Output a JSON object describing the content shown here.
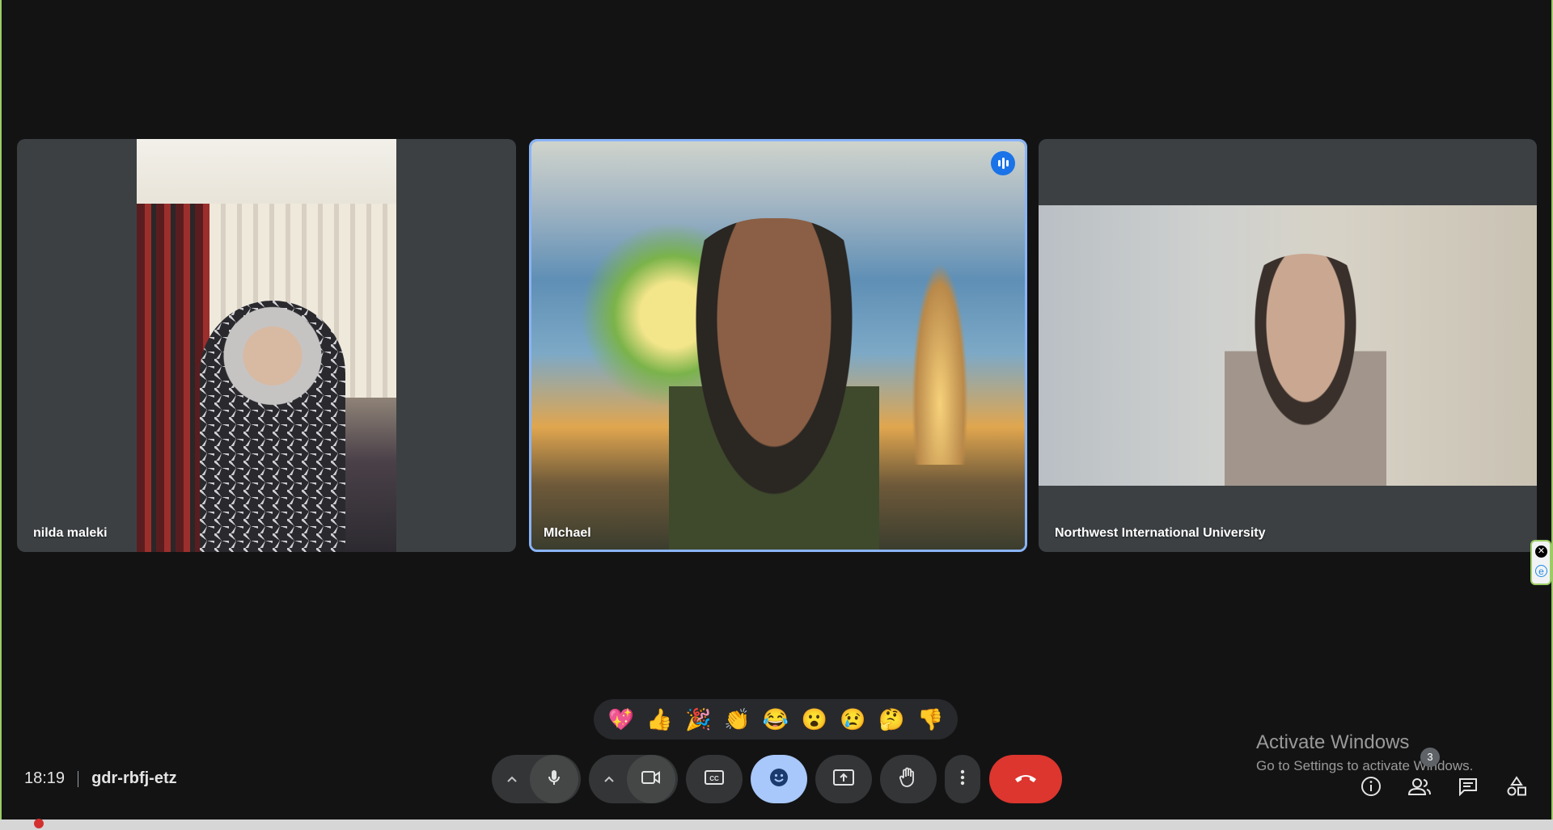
{
  "participants": [
    {
      "name": "nilda maleki"
    },
    {
      "name": "MIchael"
    },
    {
      "name": "Northwest International University"
    }
  ],
  "reactions": [
    "💖",
    "👍",
    "🎉",
    "👏",
    "😂",
    "😮",
    "😢",
    "🤔",
    "👎"
  ],
  "meeting": {
    "time": "18:19",
    "code": "gdr-rbfj-etz"
  },
  "people_count": "3",
  "watermark": {
    "line1": "Activate Windows",
    "line2": "Go to Settings to activate Windows."
  },
  "icons": {
    "mic": "microphone-icon",
    "camera": "camera-icon",
    "captions": "captions-icon",
    "emoji": "emoji-icon",
    "present": "present-screen-icon",
    "hand": "raise-hand-icon",
    "more": "more-options-icon",
    "leave": "end-call-icon",
    "info": "info-icon",
    "people": "people-icon",
    "chat": "chat-icon",
    "activities": "activities-icon"
  },
  "colors": {
    "background": "#131314",
    "speaking_border": "#8ab4f8",
    "emoji_active": "#a8c7fa",
    "leave": "#dc362e"
  }
}
